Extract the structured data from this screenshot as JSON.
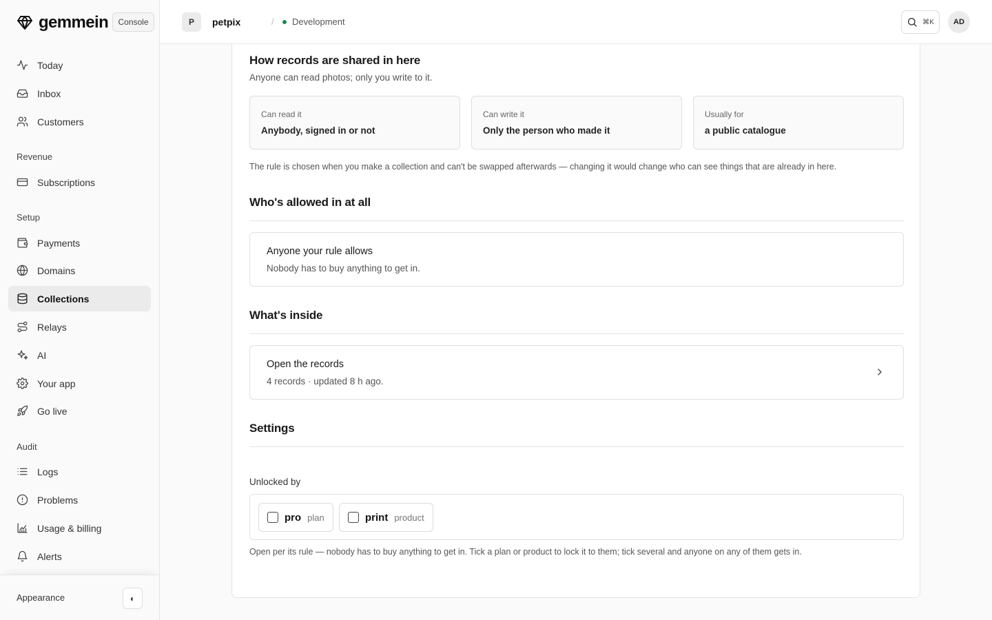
{
  "brand": {
    "name": "gemmein",
    "console_label": "Console"
  },
  "sidebar": {
    "top_items": [
      {
        "label": "Today",
        "icon": "activity-icon"
      },
      {
        "label": "Inbox",
        "icon": "inbox-icon"
      },
      {
        "label": "Customers",
        "icon": "users-icon"
      }
    ],
    "sections": {
      "revenue": "Revenue",
      "setup": "Setup",
      "audit": "Audit"
    },
    "revenue_items": [
      {
        "label": "Subscriptions",
        "icon": "credit-card-icon"
      }
    ],
    "setup_items": [
      {
        "label": "Payments",
        "icon": "wallet-icon"
      },
      {
        "label": "Domains",
        "icon": "globe-icon"
      },
      {
        "label": "Collections",
        "icon": "database-icon",
        "active": true
      },
      {
        "label": "Relays",
        "icon": "route-icon"
      },
      {
        "label": "AI",
        "icon": "sparkles-icon"
      },
      {
        "label": "Your app",
        "icon": "gear-icon"
      },
      {
        "label": "Go live",
        "icon": "rocket-icon"
      }
    ],
    "audit_items": [
      {
        "label": "Logs",
        "icon": "list-icon"
      },
      {
        "label": "Problems",
        "icon": "alert-circle-icon"
      },
      {
        "label": "Usage & billing",
        "icon": "chart-icon"
      },
      {
        "label": "Alerts",
        "icon": "bell-icon"
      }
    ],
    "footer": {
      "appearance_label": "Appearance",
      "toggle_glyph": "◐"
    }
  },
  "topbar": {
    "project_initial": "P",
    "project_name": "petpix",
    "separator": "/",
    "environment": "Development",
    "environment_color": "#1f8a4c",
    "search_shortcut": "⌘K",
    "user_initials": "AD"
  },
  "sharing": {
    "title": "How records are shared in here",
    "subtitle": "Anyone can read photos; only you write to it.",
    "boxes": [
      {
        "label": "Can read it",
        "value": "Anybody, signed in or not"
      },
      {
        "label": "Can write it",
        "value": "Only the person who made it"
      },
      {
        "label": "Usually for",
        "value": "a public catalogue"
      }
    ],
    "note": "The rule is chosen when you make a collection and can't be swapped afterwards — changing it would change who can see things that are already in here."
  },
  "access": {
    "title": "Who's allowed in at all",
    "panel_title": "Anyone your rule allows",
    "panel_desc": "Nobody has to buy anything to get in."
  },
  "inside": {
    "title": "What's inside",
    "panel_title": "Open the records",
    "panel_desc": "4 records · updated 8 h ago."
  },
  "settings": {
    "title": "Settings",
    "unlocked_label": "Unlocked by",
    "options": [
      {
        "key": "pro",
        "type": "plan",
        "checked": false
      },
      {
        "key": "print",
        "type": "product",
        "checked": false
      }
    ],
    "note": "Open per its rule — nobody has to buy anything to get in. Tick a plan or product to lock it to them; tick several and anyone on any of them gets in."
  }
}
